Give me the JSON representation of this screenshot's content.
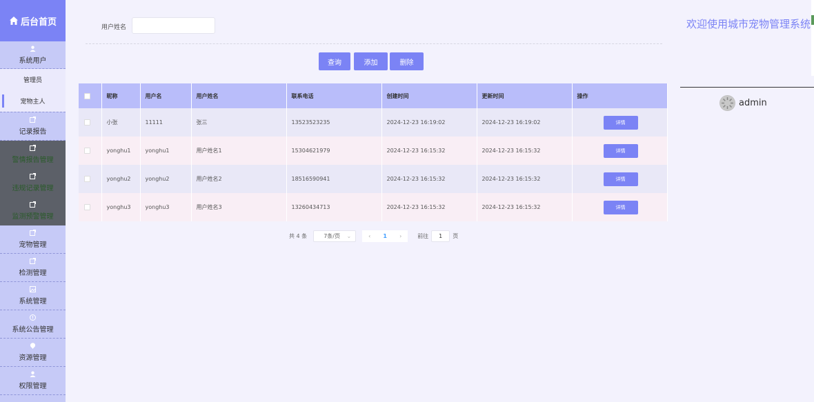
{
  "sidebar": {
    "logo": "后台首页",
    "section_users": "系统用户",
    "sub_items": [
      "管理员",
      "宠物主人"
    ],
    "items": [
      "记录报告",
      "警情报告管理",
      "违规记录管理",
      "监测预警管理",
      "宠物管理",
      "检测管理",
      "系统管理",
      "系统公告管理",
      "资源管理",
      "权限管理"
    ]
  },
  "search": {
    "label": "用户姓名",
    "value": ""
  },
  "buttons": {
    "query": "查询",
    "add": "添加",
    "delete": "删除"
  },
  "table": {
    "columns": [
      "昵称",
      "用户名",
      "用户姓名",
      "联系电话",
      "创建时间",
      "更新时间",
      "操作"
    ],
    "rows": [
      [
        "小张",
        "11111",
        "张三",
        "13523523235",
        "2024-12-23 16:19:02",
        "2024-12-23 16:19:02"
      ],
      [
        "yonghu1",
        "yonghu1",
        "用户姓名1",
        "15304621979",
        "2024-12-23 16:15:32",
        "2024-12-23 16:15:32"
      ],
      [
        "yonghu2",
        "yonghu2",
        "用户姓名2",
        "18516590941",
        "2024-12-23 16:15:32",
        "2024-12-23 16:15:32"
      ],
      [
        "yonghu3",
        "yonghu3",
        "用户姓名3",
        "13260434713",
        "2024-12-23 16:15:32",
        "2024-12-23 16:15:32"
      ]
    ],
    "detail_label": "详情"
  },
  "pagination": {
    "total": "共 4 条",
    "page_size": "7条/页",
    "current": "1",
    "goto_prefix": "前往",
    "goto_value": "1",
    "goto_suffix": "页"
  },
  "header": {
    "welcome": "欢迎使用城市宠物管理系统",
    "username": "admin"
  },
  "colors": {
    "accent": "#7b83f5",
    "sidebar": "#c6caf7",
    "header_row": "#b9bdfa"
  }
}
